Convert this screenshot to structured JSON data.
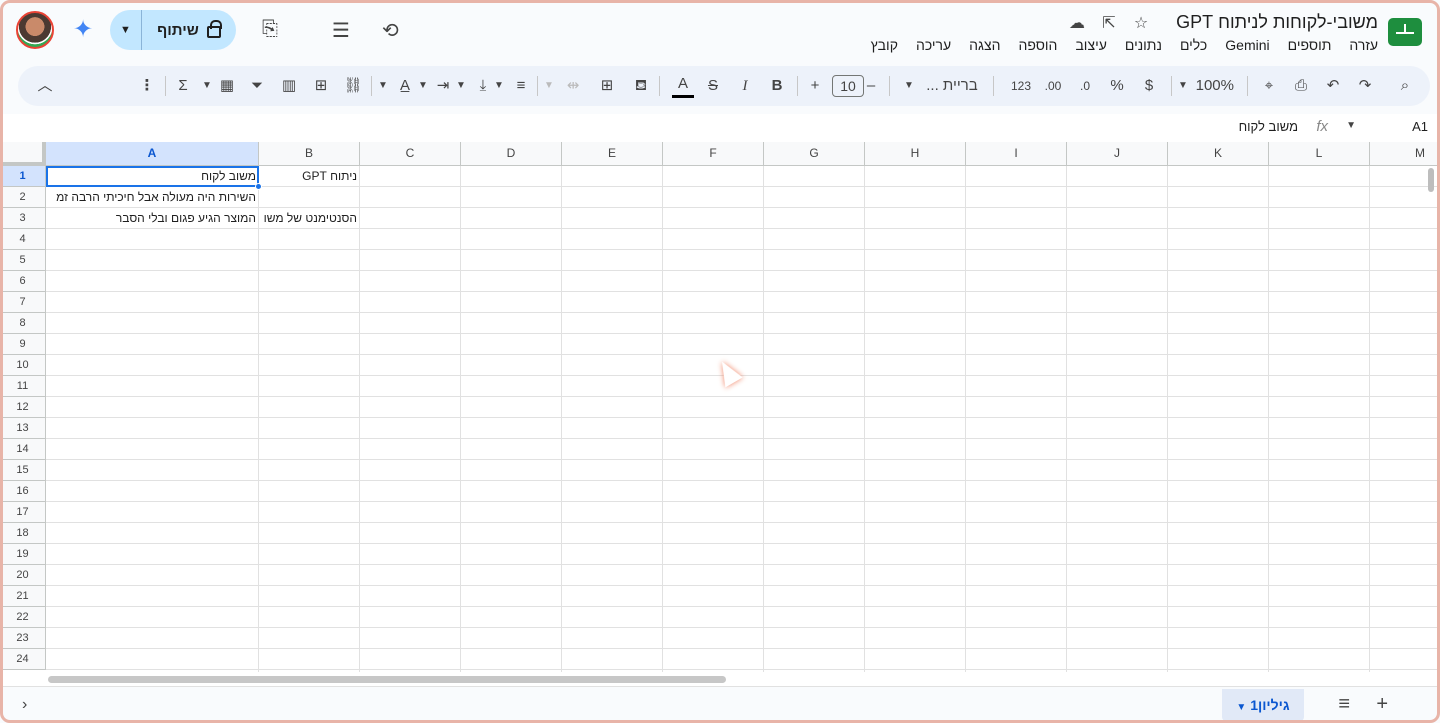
{
  "header": {
    "title": "משובי-לקוחות לניתוח GPT",
    "menu": [
      "קובץ",
      "עריכה",
      "הצגה",
      "הוספה",
      "עיצוב",
      "נתונים",
      "כלים",
      "Gemini",
      "תוספים",
      "עזרה"
    ],
    "share_label": "שיתוף",
    "icons": {
      "star": "star-icon",
      "move": "move-folder-icon",
      "cloud": "cloud-saved-icon",
      "history": "history-icon",
      "comments": "comments-icon",
      "meet": "video-call-icon",
      "gemini": "gemini-sparkle-icon"
    }
  },
  "toolbar": {
    "zoom": "100%",
    "currency": "$",
    "percent": "%",
    "dec_decrease": ".0",
    "dec_increase": ".00",
    "format_123": "123",
    "font": "בריית ...",
    "font_size": "10",
    "minus": "–",
    "plus": "+",
    "bold": "B",
    "italic": "I",
    "strike": "S",
    "text_color": "A"
  },
  "formula_bar": {
    "name_box": "A1",
    "fx": "fx",
    "value": "משוב לקוח"
  },
  "columns": [
    "A",
    "B",
    "C",
    "D",
    "E",
    "F",
    "G",
    "H",
    "I",
    "J",
    "K",
    "L",
    "M"
  ],
  "rows": [
    "1",
    "2",
    "3",
    "4",
    "5",
    "6",
    "7",
    "8",
    "9",
    "10",
    "11",
    "12",
    "13",
    "14",
    "15",
    "16",
    "17",
    "18",
    "19",
    "20",
    "21",
    "22",
    "23",
    "24"
  ],
  "cells": {
    "A1": "משוב לקוח",
    "B1": "ניתוח GPT",
    "A2": "השירות היה מעולה אבל חיכיתי הרבה זמ",
    "A3": "המוצר הגיע פגום ובלי הסבר",
    "B3": "הסנטימנט של משו"
  },
  "sheets": {
    "active": "גיליון1"
  },
  "colors": {
    "accent": "#1a73e8",
    "share_bg": "#c2e7ff",
    "toolbar_bg": "#edf2fa",
    "logo": "#1e8e3e"
  }
}
